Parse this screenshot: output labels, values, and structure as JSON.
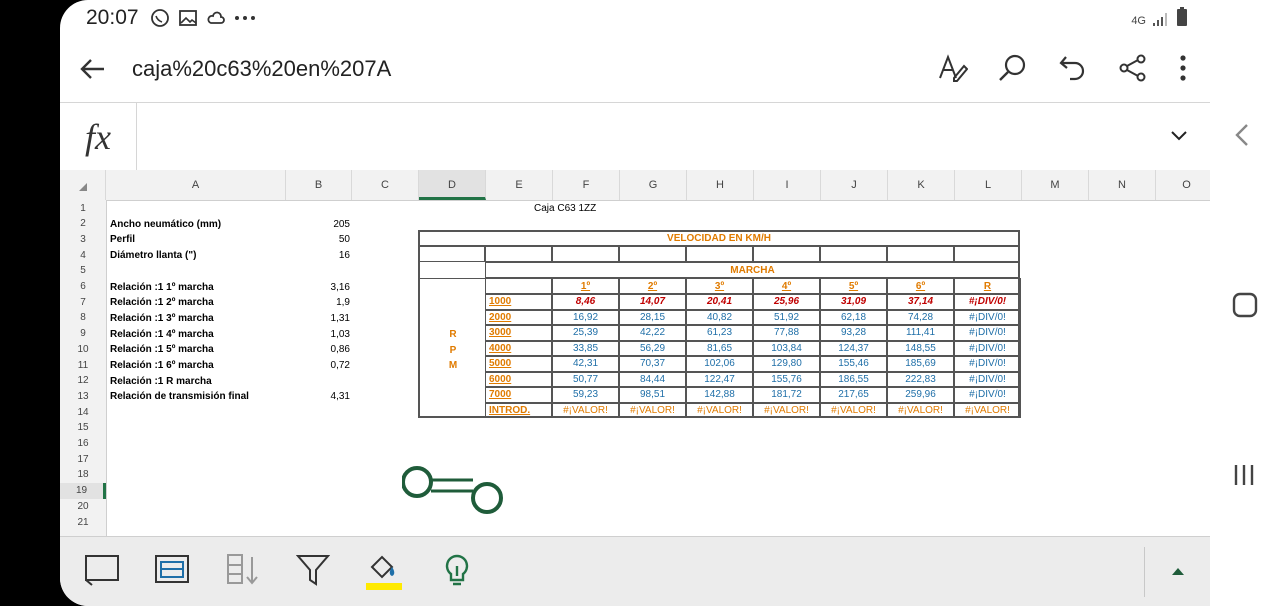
{
  "status": {
    "time": "20:07",
    "network": "4G"
  },
  "app": {
    "title": "caja%20c63%20en%207A"
  },
  "formula": {
    "label": "fx",
    "value": ""
  },
  "columns": [
    "A",
    "B",
    "C",
    "D",
    "E",
    "F",
    "G",
    "H",
    "I",
    "J",
    "K",
    "L",
    "M",
    "N",
    "O"
  ],
  "rows": [
    "1",
    "2",
    "3",
    "4",
    "5",
    "6",
    "7",
    "8",
    "9",
    "10",
    "11",
    "12",
    "13",
    "14",
    "15",
    "16",
    "17",
    "18",
    "19",
    "20",
    "21"
  ],
  "selected_row": "19",
  "selected_col": "D",
  "sheet": {
    "title_cell": "Caja C63 1ZZ",
    "params": [
      {
        "label": "Ancho neumático (mm)",
        "value": "205"
      },
      {
        "label": "Perfil",
        "value": "50"
      },
      {
        "label": "Diámetro llanta (\")",
        "value": "16"
      },
      {
        "label": "",
        "value": ""
      },
      {
        "label": "Relación :1 1º marcha",
        "value": "3,16"
      },
      {
        "label": "Relación :1 2º marcha",
        "value": "1,9"
      },
      {
        "label": "Relación :1 3º marcha",
        "value": "1,31"
      },
      {
        "label": "Relación :1 4º marcha",
        "value": "1,03"
      },
      {
        "label": "Relación :1 5º marcha",
        "value": "0,86"
      },
      {
        "label": "Relación :1 6º marcha",
        "value": "0,72"
      },
      {
        "label": "Relación :1 R marcha",
        "value": ""
      },
      {
        "label": "Relación de transmisión final",
        "value": "4,31"
      }
    ],
    "velocity_title": "VELOCIDAD EN KM/H",
    "marcha_title": "MARCHA",
    "rpm_letters": [
      "R",
      "P",
      "M"
    ],
    "gears": [
      "1º",
      "2º",
      "3º",
      "4º",
      "5º",
      "6º",
      "R"
    ],
    "table": [
      {
        "rpm": "1000",
        "vals": [
          "8,46",
          "14,07",
          "20,41",
          "25,96",
          "31,09",
          "37,14",
          "#¡DIV/0!"
        ]
      },
      {
        "rpm": "2000",
        "vals": [
          "16,92",
          "28,15",
          "40,82",
          "51,92",
          "62,18",
          "74,28",
          "#¡DIV/0!"
        ]
      },
      {
        "rpm": "3000",
        "vals": [
          "25,39",
          "42,22",
          "61,23",
          "77,88",
          "93,28",
          "111,41",
          "#¡DIV/0!"
        ]
      },
      {
        "rpm": "4000",
        "vals": [
          "33,85",
          "56,29",
          "81,65",
          "103,84",
          "124,37",
          "148,55",
          "#¡DIV/0!"
        ]
      },
      {
        "rpm": "5000",
        "vals": [
          "42,31",
          "70,37",
          "102,06",
          "129,80",
          "155,46",
          "185,69",
          "#¡DIV/0!"
        ]
      },
      {
        "rpm": "6000",
        "vals": [
          "50,77",
          "84,44",
          "122,47",
          "155,76",
          "186,55",
          "222,83",
          "#¡DIV/0!"
        ]
      },
      {
        "rpm": "7000",
        "vals": [
          "59,23",
          "98,51",
          "142,88",
          "181,72",
          "217,65",
          "259,96",
          "#¡DIV/0!"
        ]
      },
      {
        "rpm": "INTROD.",
        "vals": [
          "#¡VALOR!",
          "#¡VALOR!",
          "#¡VALOR!",
          "#¡VALOR!",
          "#¡VALOR!",
          "#¡VALOR!",
          "#¡VALOR!"
        ]
      }
    ]
  },
  "colors": {
    "accent": "#217346",
    "blue": "#1f6fa8",
    "orange": "#e07b00",
    "red": "#c00000",
    "highlight": "#ffea00"
  }
}
